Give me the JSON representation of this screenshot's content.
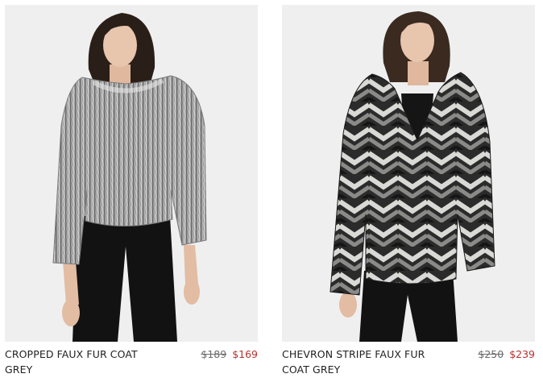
{
  "products": [
    {
      "name": "CROPPED FAUX FUR COAT GREY",
      "original_price": "$189",
      "sale_price": "$169",
      "image_alt": "Model wearing cropped grey faux fur coat"
    },
    {
      "name": "CHEVRON STRIPE FAUX FUR COAT GREY",
      "original_price": "$250",
      "sale_price": "$239",
      "image_alt": "Model wearing black and grey chevron stripe faux fur coat"
    }
  ],
  "colors": {
    "image_background": "#efefef",
    "sale_price": "#b5322f",
    "original_price": "#6b6b6b",
    "product_name": "#222222"
  }
}
